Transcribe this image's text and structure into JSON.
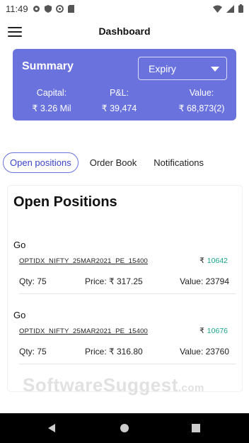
{
  "status_bar": {
    "time": "11:49",
    "icons": [
      "settings-icon",
      "shield-icon",
      "vpn-icon",
      "sd-card-icon",
      "wifi-icon",
      "signal-icon",
      "battery-icon"
    ]
  },
  "app_bar": {
    "title": "Dashboard",
    "menu_icon": "hamburger-menu-icon"
  },
  "summary": {
    "title": "Summary",
    "filter": {
      "selected": "Expiry"
    },
    "capital": {
      "label": "Capital:",
      "value": "₹  3.26 Mil"
    },
    "pnl": {
      "label": "P&L:",
      "value": "₹  39,474"
    },
    "value": {
      "label": "Value:",
      "value": "₹  68,873(2)"
    },
    "bg_color": "#6A72DD"
  },
  "tabs": [
    {
      "label": "Open positions",
      "active": true
    },
    {
      "label": "Order Book",
      "active": false
    },
    {
      "label": "Notifications",
      "active": false
    }
  ],
  "open_positions": {
    "title": "Open Positions",
    "items": [
      {
        "name": "Go",
        "symbol": "OPTIDX_NIFTY_25MAR2021_PE_15400",
        "currency": "₹",
        "price": "10642",
        "qty": "Qty: 75",
        "price_label": "Price: ₹  317.25",
        "value": "Value: 23794"
      },
      {
        "name": "Go",
        "symbol": "OPTIDX_NIFTY_25MAR2021_PE_15400",
        "currency": "₹",
        "price": "10676",
        "qty": "Qty: 75",
        "price_label": "Price: ₹  316.80",
        "value": "Value: 23760"
      }
    ],
    "accent_color": "#1aa38a"
  },
  "watermark": {
    "main": "SoftwareSuggest",
    "suffix": ".com"
  },
  "nav_bar": {
    "icons": [
      "back-icon",
      "home-icon",
      "recents-icon"
    ]
  }
}
